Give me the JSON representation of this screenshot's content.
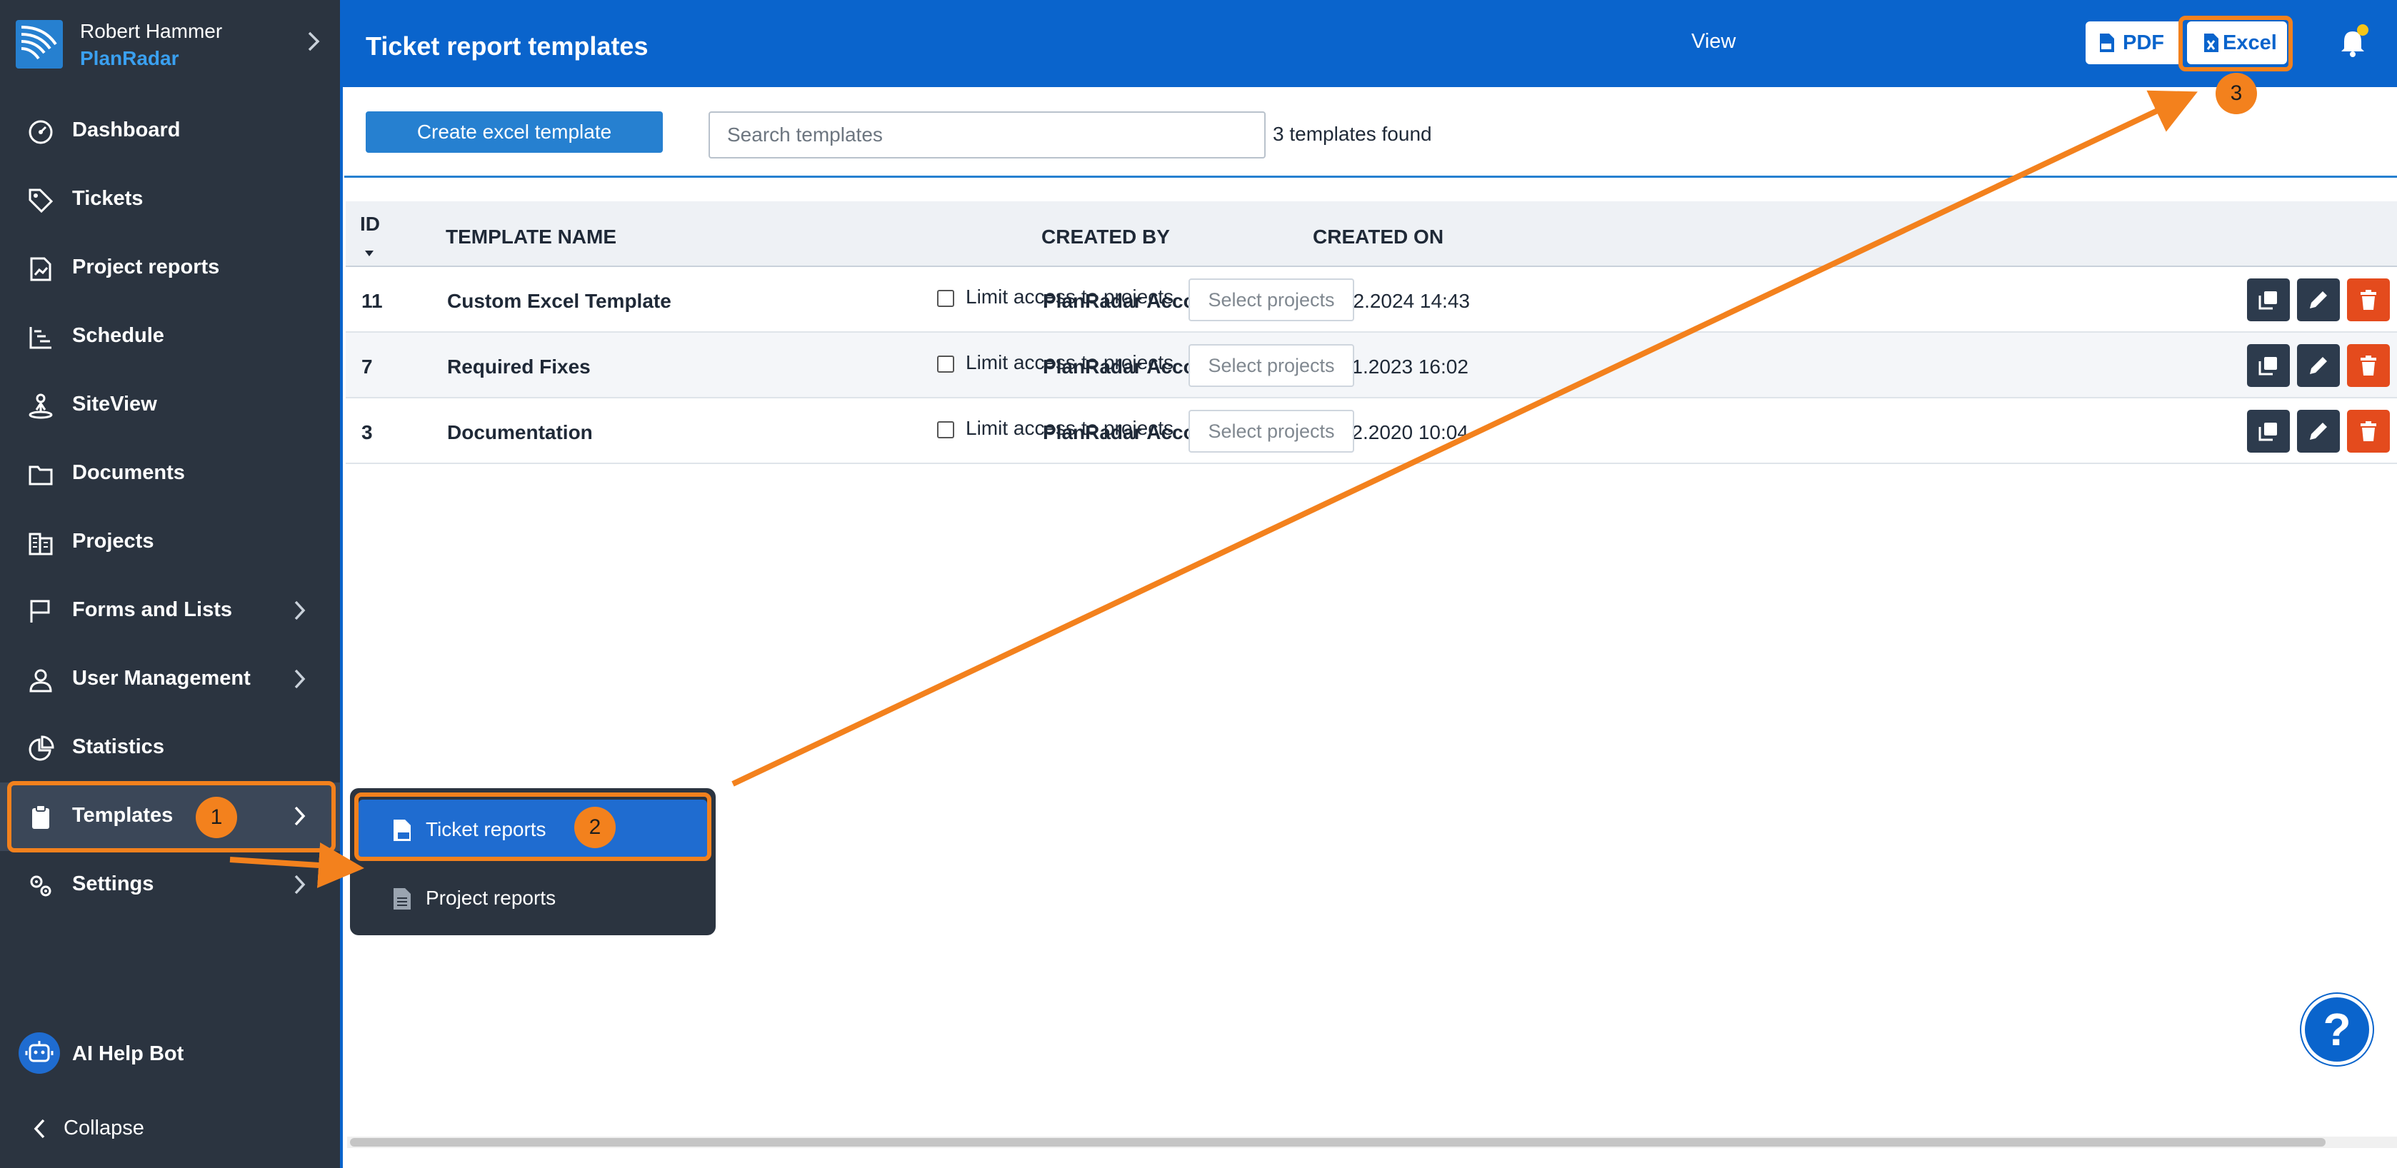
{
  "brand": {
    "user_name": "Robert Hammer",
    "company": "PlanRadar"
  },
  "sidebar": {
    "items": [
      {
        "label": "Dashboard",
        "icon": "dashboard-gauge-icon"
      },
      {
        "label": "Tickets",
        "icon": "tag-icon"
      },
      {
        "label": "Project reports",
        "icon": "report-icon"
      },
      {
        "label": "Schedule",
        "icon": "schedule-chart-icon"
      },
      {
        "label": "SiteView",
        "icon": "siteview-person-icon"
      },
      {
        "label": "Documents",
        "icon": "folder-icon"
      },
      {
        "label": "Projects",
        "icon": "buildings-icon"
      },
      {
        "label": "Forms and Lists",
        "icon": "flag-icon"
      },
      {
        "label": "User Management",
        "icon": "user-icon"
      },
      {
        "label": "Statistics",
        "icon": "pie-chart-icon"
      },
      {
        "label": "Templates",
        "icon": "clipboard-icon"
      },
      {
        "label": "Settings",
        "icon": "gears-icon"
      }
    ],
    "ai_help_bot": "AI Help Bot",
    "collapse": "Collapse"
  },
  "header": {
    "title": "Ticket report templates",
    "view_label": "View",
    "pdf_label": "PDF",
    "excel_label": "Excel"
  },
  "toolbar": {
    "create_label": "Create excel template",
    "search_placeholder": "Search templates",
    "found_text": "3 templates found"
  },
  "table": {
    "columns": [
      "ID",
      "TEMPLATE NAME",
      "CREATED BY",
      "CREATED ON"
    ],
    "limit_label": "Limit access to projects",
    "select_label": "Select projects",
    "rows": [
      {
        "id": "11",
        "name": "Custom Excel Template",
        "created_by": "PlanRadar Account",
        "created_on": "05.02.2024 14:43"
      },
      {
        "id": "7",
        "name": "Required Fixes",
        "created_by": "PlanRadar Account",
        "created_on": "30.11.2023 16:02"
      },
      {
        "id": "3",
        "name": "Documentation",
        "created_by": "PlanRadar Account",
        "created_on": "11.12.2020 10:04"
      }
    ]
  },
  "flyout": {
    "items": [
      {
        "label": "Ticket reports",
        "icon": "pdf-file-icon"
      },
      {
        "label": "Project reports",
        "icon": "document-list-icon"
      }
    ]
  },
  "annotations": {
    "step1": "1",
    "step2": "2",
    "step3": "3"
  },
  "colors": {
    "accent": "#0a64cc",
    "annotation": "#f3811d",
    "sidebar": "#2b3440",
    "delete": "#e44b1d"
  },
  "help_label": "?"
}
